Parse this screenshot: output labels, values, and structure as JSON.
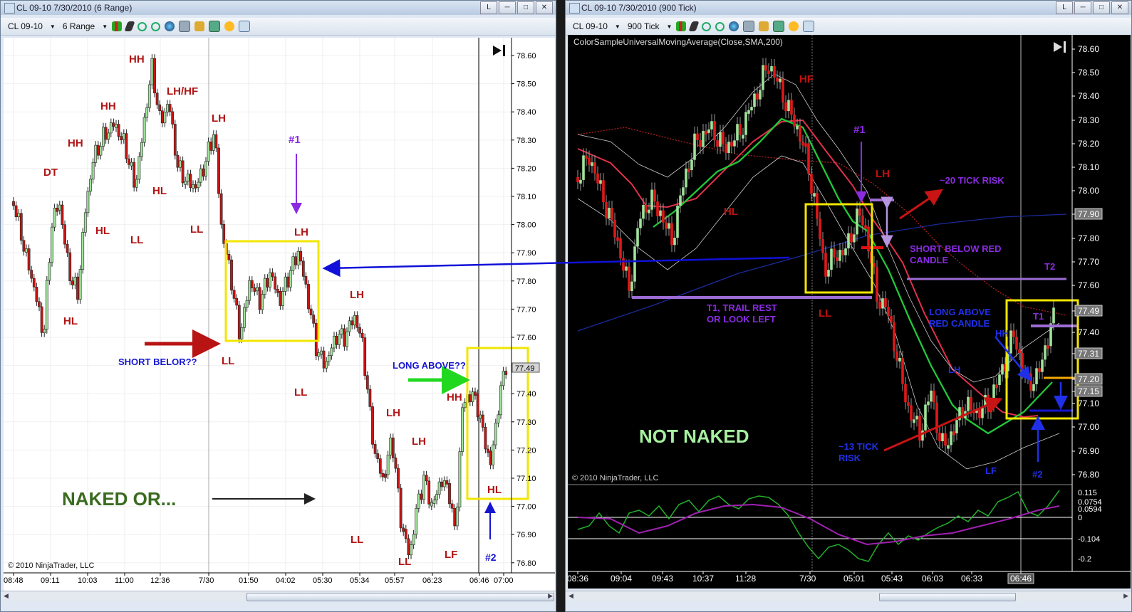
{
  "left_window": {
    "title": "CL 09-10  7/30/2010 (6 Range)",
    "link_btn": "L",
    "toolbar": {
      "instrument": "CL 09-10",
      "interval": "6 Range"
    },
    "price_ticks": [
      "78.60",
      "78.50",
      "78.40",
      "78.30",
      "78.20",
      "78.10",
      "78.00",
      "77.90",
      "77.80",
      "77.70",
      "77.60",
      "77.50",
      "77.40",
      "77.30",
      "77.20",
      "77.10",
      "77.00",
      "76.90",
      "76.80"
    ],
    "last_price": "77.49",
    "time_ticks": [
      "08:48",
      "09:11",
      "10:03",
      "11:00",
      "12:36",
      "7/30",
      "01:50",
      "04:02",
      "05:30",
      "05:34",
      "05:57",
      "06:23",
      "06:46",
      "07:00"
    ],
    "copyright": "© 2010 NinjaTrader, LLC",
    "labels": {
      "hh1": "HH",
      "hh2": "HH",
      "hh3": "HH",
      "lhhf": "LH/HF",
      "lh1": "LH",
      "dt": "DT",
      "hl1": "HL",
      "hl2": "HL",
      "hl3": "HL",
      "ll1": "LL",
      "ll2": "LL",
      "num1": "#1",
      "lh2": "LH",
      "lh3": "LH",
      "short": "SHORT BELOR??",
      "ll3": "LL",
      "ll4": "LL",
      "lh4": "LH",
      "lh5": "LH",
      "long": "LONG ABOVE??",
      "hh4": "HH",
      "hl4": "HL",
      "num2": "#2",
      "ll5": "LL",
      "ll6": "LL",
      "lf": "LF",
      "naked": "NAKED OR..."
    }
  },
  "right_window": {
    "title": "CL 09-10  7/30/2010 (900 Tick)",
    "link_btn": "L",
    "toolbar": {
      "instrument": "CL 09-10",
      "interval": "900 Tick"
    },
    "indicator": "ColorSampleUniversalMovingAverage(Close,SMA,200)",
    "price_ticks": [
      "78.60",
      "78.50",
      "78.40",
      "78.30",
      "78.20",
      "78.10",
      "78.00",
      "77.90",
      "77.80",
      "77.70",
      "77.60",
      "77.49",
      "77.40",
      "77.31",
      "77.20",
      "77.15",
      "77.10",
      "77.00",
      "76.90",
      "76.80"
    ],
    "indicator_ticks": [
      "0.115",
      "0.0754",
      "0.0594",
      "0",
      "-0.104",
      "-0.2"
    ],
    "time_ticks": [
      "08:36",
      "09:04",
      "09:43",
      "10:37",
      "11:28",
      "7/30",
      "05:01",
      "05:43",
      "06:03",
      "06:33",
      "06:46"
    ],
    "copyright": "© 2010 NinjaTrader, LLC",
    "labels": {
      "hf": "HF",
      "hl": "HL",
      "num1": "#1",
      "lh": "LH",
      "risk20": "~20 TICK RISK",
      "short1": "SHORT BELOW RED",
      "short2": "CANDLE",
      "t1trail1": "T1, TRAIL REST",
      "t1trail2": "OR LOOK LEFT",
      "ll": "LL",
      "t2": "T2",
      "long1": "LONG ABOVE",
      "long2": "RED CANDLE",
      "hh": "HH",
      "t1": "T1",
      "lh2": "LH",
      "risk13a": "~13 TICK",
      "risk13b": "RISK",
      "lf": "LF",
      "num2": "#2",
      "notnaked": "NOT NAKED"
    }
  },
  "colors": {
    "bull_candle": "#9fe39a",
    "bear_candle": "#c81414",
    "annot_red": "#b01414",
    "annot_purple": "#8a2be2",
    "annot_blue": "#1010c8",
    "highlight_yellow": "#f2e600"
  }
}
